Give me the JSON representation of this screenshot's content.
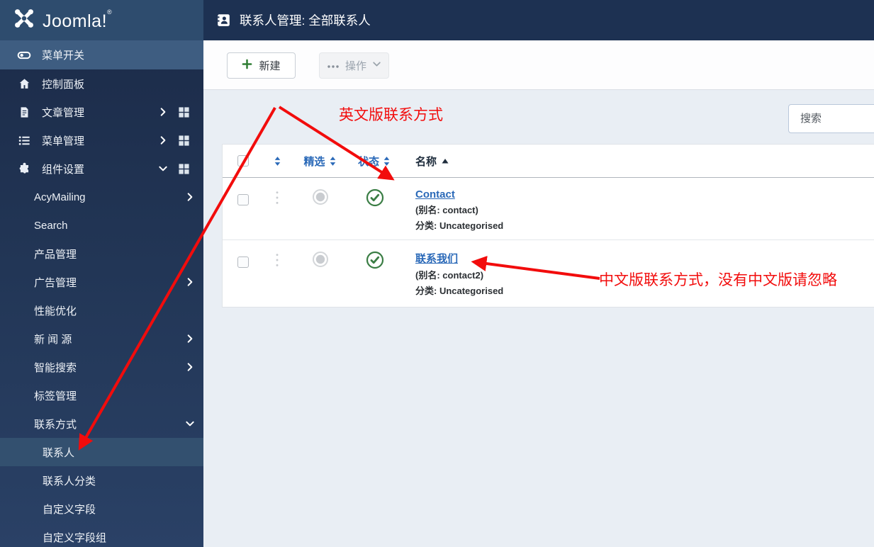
{
  "brand": {
    "name": "Joomla!",
    "trademark": "®"
  },
  "header": {
    "title": "联系人管理: 全部联系人"
  },
  "toolbar": {
    "new": "新建",
    "actions": "操作"
  },
  "filters": {
    "search_placeholder": "搜索"
  },
  "sidebar": {
    "toggle": {
      "label": "菜单开关",
      "icon": "menu-toggle-icon"
    },
    "items": [
      {
        "label": "控制面板",
        "icon": "home-icon",
        "level": 1
      },
      {
        "label": "文章管理",
        "icon": "article-icon",
        "level": 1,
        "chevron": "right",
        "grid": true
      },
      {
        "label": "菜单管理",
        "icon": "menu-list-icon",
        "level": 1,
        "chevron": "right",
        "grid": true
      },
      {
        "label": "组件设置",
        "icon": "puzzle-icon",
        "level": 1,
        "chevron": "down",
        "grid": true
      },
      {
        "label": "AcyMailing",
        "level": 2,
        "chevron": "right"
      },
      {
        "label": "Search",
        "level": 2
      },
      {
        "label": "产品管理",
        "level": 2
      },
      {
        "label": "广告管理",
        "level": 2,
        "chevron": "right"
      },
      {
        "label": "性能优化",
        "level": 2
      },
      {
        "label": "新 闻 源",
        "level": 2,
        "chevron": "right"
      },
      {
        "label": "智能搜索",
        "level": 2,
        "chevron": "right"
      },
      {
        "label": "标签管理",
        "level": 2
      },
      {
        "label": "联系方式",
        "level": 2,
        "chevron": "down"
      },
      {
        "label": "联系人",
        "level": 3,
        "selected": true
      },
      {
        "label": "联系人分类",
        "level": 3
      },
      {
        "label": "自定义字段",
        "level": 3
      },
      {
        "label": "自定义字段组",
        "level": 3
      }
    ]
  },
  "table": {
    "headers": {
      "featured": "精选",
      "status": "状态",
      "name": "名称"
    },
    "rows": [
      {
        "name": "Contact",
        "alias": "(别名: contact)",
        "category": "分类: Uncategorised",
        "featured": "off",
        "status": "published"
      },
      {
        "name": "联系我们",
        "alias": "(别名: contact2)",
        "category": "分类: Uncategorised",
        "featured": "off",
        "status": "published"
      }
    ]
  },
  "annotations": {
    "english_label": "英文版联系方式",
    "chinese_label": "中文版联系方式，没有中文版请忽略"
  },
  "colors": {
    "annotation_red": "#f20c0c",
    "link_blue": "#2a69b8",
    "status_green": "#3a7d44",
    "header_navy": "#1d3152",
    "sidebar_top": "#2e4c6e",
    "toggle_row": "#3e5d81",
    "content_bg": "#e9eef4"
  }
}
